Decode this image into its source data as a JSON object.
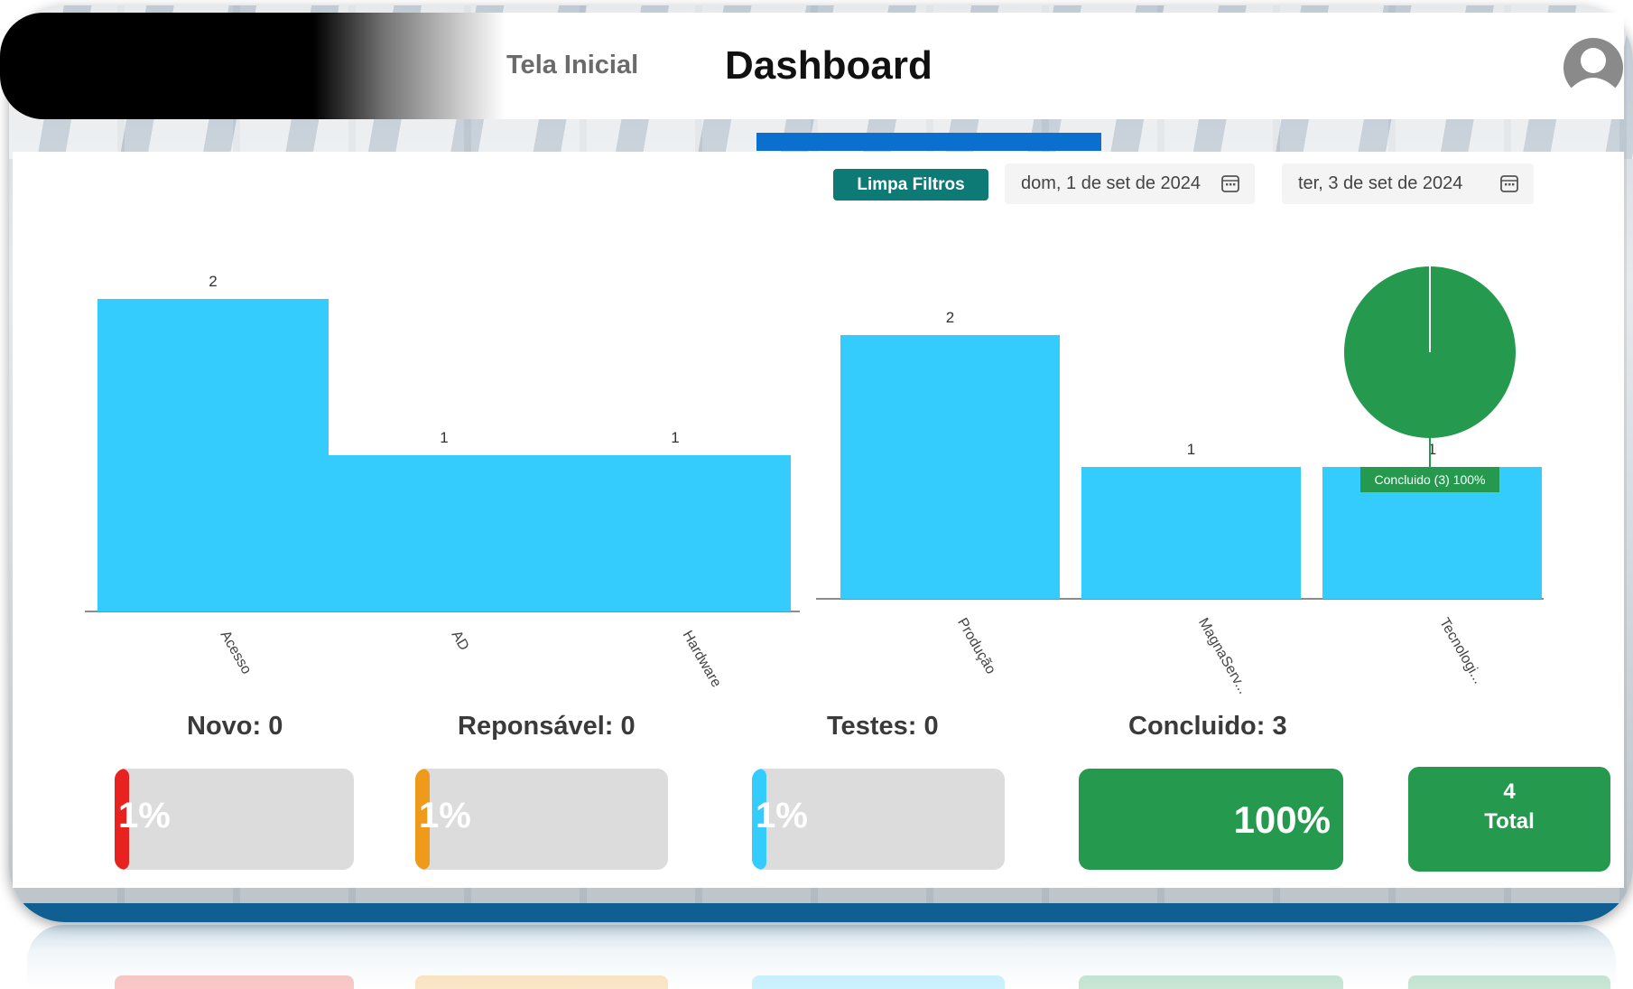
{
  "header": {
    "nav_home": "Tela Inicial",
    "nav_title": "Dashboard"
  },
  "filters": {
    "clear_label": "Limpa Filtros",
    "date_start": "dom, 1 de set de 2024",
    "date_end": "ter, 3 de set de 2024"
  },
  "chart_data": [
    {
      "type": "bar",
      "categories": [
        "Acesso",
        "AD",
        "Hardware"
      ],
      "values": [
        2,
        1,
        1
      ],
      "color": "#33ccfc"
    },
    {
      "type": "bar",
      "categories": [
        "Produção",
        "MagnaServ...",
        "Tecnologi..."
      ],
      "values": [
        2,
        1,
        1
      ],
      "color": "#33ccfc"
    },
    {
      "type": "pie",
      "slices": [
        {
          "label": "Concluido (3)  100%",
          "value": 100,
          "color": "#259a4f"
        }
      ]
    }
  ],
  "stats": {
    "novo_label": "Novo: 0",
    "responsavel_label": "Reponsável: 0",
    "testes_label": "Testes: 0",
    "concluido_label": "Concluido: 3",
    "novo_pct": "1%",
    "responsavel_pct": "1%",
    "testes_pct": "1%",
    "concluido_pct": "100%",
    "total_value": "4",
    "total_label": "Total",
    "colors": {
      "novo": "#e8231f",
      "responsavel": "#ef9a1b",
      "testes": "#33ccfc",
      "concluido": "#259a4f"
    }
  }
}
